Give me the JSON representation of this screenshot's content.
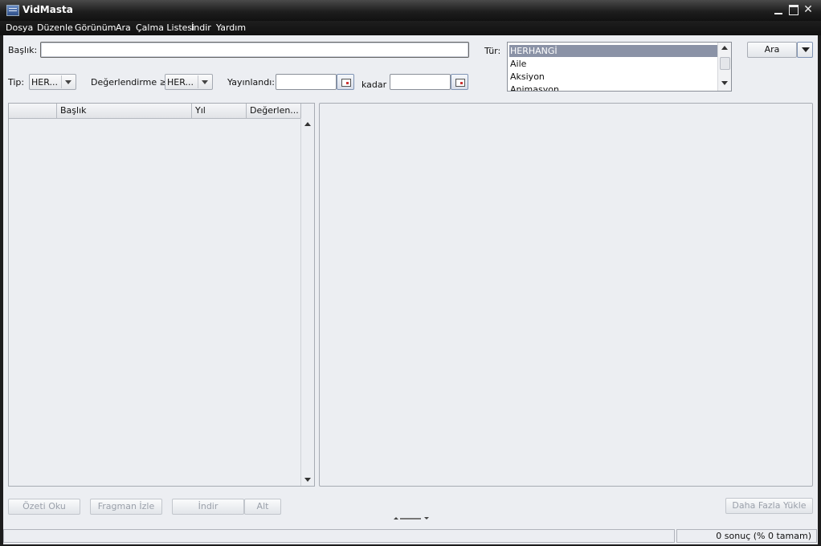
{
  "window": {
    "title": "VidMasta"
  },
  "menu": [
    "Dosya",
    "Düzenle",
    "Görünüm",
    "Ara",
    "Çalma Listesi",
    "İndir",
    "Yardım"
  ],
  "search": {
    "title_label": "Başlık:",
    "title_value": "",
    "type_label": "Tip:",
    "type_value": "HER...",
    "rating_label": "Değerlendirme ≥:",
    "rating_value": "HER...",
    "released_label": "Yayınlandı:",
    "released_from": "",
    "until_label": "kadar",
    "released_to": "",
    "genre_label": "Tür:",
    "genres": [
      "HERHANGİ",
      "Aile",
      "Aksiyon",
      "Animasyon"
    ],
    "selected_genre": "HERHANGİ",
    "search_button": "Ara"
  },
  "results": {
    "columns": [
      "",
      "Başlık",
      "Yıl",
      "Değerlen..."
    ],
    "rows": []
  },
  "actions": {
    "read_summary": "Özeti Oku",
    "watch_trailer": "Fragman İzle",
    "download": "İndir",
    "subtitle": "Alt",
    "load_more": "Daha Fazla Yükle"
  },
  "status": {
    "left": "",
    "right": "0 sonuç (% 0 tamam)"
  }
}
